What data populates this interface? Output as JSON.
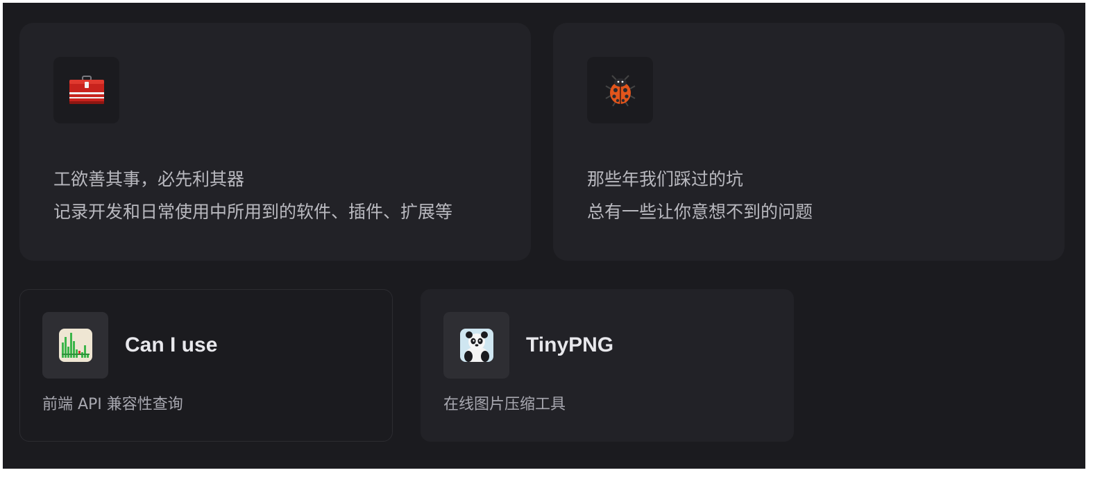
{
  "features": [
    {
      "icon": "toolbox-icon",
      "line1": "工欲善其事，必先利其器",
      "line2": "记录开发和日常使用中所用到的软件、插件、扩展等"
    },
    {
      "icon": "ladybug-icon",
      "line1": "那些年我们踩过的坑",
      "line2": "总有一些让你意想不到的问题"
    }
  ],
  "links": [
    {
      "icon": "caniuse-icon",
      "title": "Can I use",
      "description": "前端 API 兼容性查询"
    },
    {
      "icon": "tinypng-panda-icon",
      "title": "TinyPNG",
      "description": "在线图片压缩工具"
    }
  ],
  "colors": {
    "page_background": "#1b1b1f",
    "card_background": "#222227",
    "icon_box_background": "#2e2e33",
    "text_primary": "#e8e8ec",
    "text_secondary": "#b9b9bf"
  }
}
